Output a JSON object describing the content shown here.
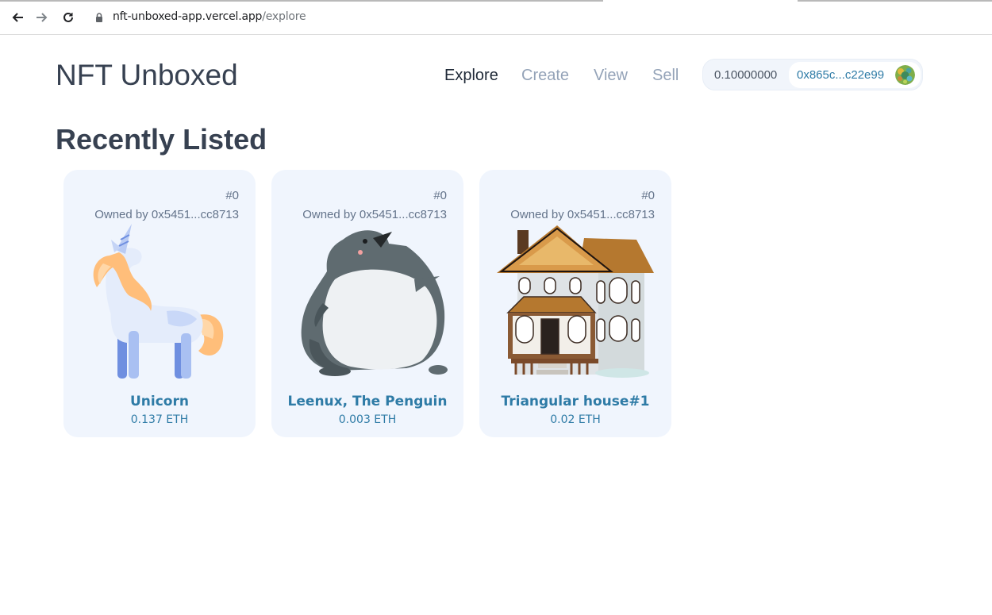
{
  "browser": {
    "url_host": "nft-unboxed-app.vercel.app",
    "url_path": "/explore"
  },
  "header": {
    "logo": "NFT Unboxed",
    "nav": [
      {
        "label": "Explore",
        "active": true
      },
      {
        "label": "Create",
        "active": false
      },
      {
        "label": "View",
        "active": false
      },
      {
        "label": "Sell",
        "active": false
      }
    ],
    "wallet": {
      "balance": "0.10000000",
      "address": "0x865c...c22e99"
    }
  },
  "main": {
    "title": "Recently Listed",
    "cards": [
      {
        "token_id": "#0",
        "owner": "Owned by 0x5451...cc8713",
        "name": "Unicorn",
        "price": "0.137 ETH",
        "image": "unicorn-image"
      },
      {
        "token_id": "#0",
        "owner": "Owned by 0x5451...cc8713",
        "name": "Leenux, The Penguin",
        "price": "0.003 ETH",
        "image": "penguin-image"
      },
      {
        "token_id": "#0",
        "owner": "Owned by 0x5451...cc8713",
        "name": "Triangular house#1",
        "price": "0.02 ETH",
        "image": "house-image"
      }
    ]
  },
  "colors": {
    "accent": "#2e7ba6",
    "card_bg": "#f0f5fd",
    "nav_inactive": "#94a3b8"
  }
}
